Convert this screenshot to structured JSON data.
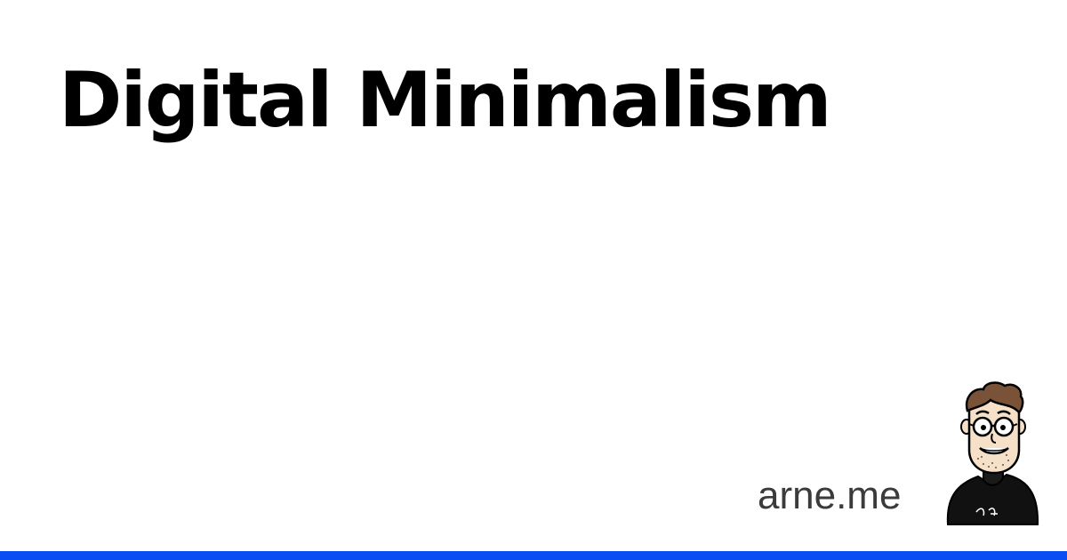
{
  "card": {
    "title": "Digital Minimalism",
    "site_label": "arne.me"
  },
  "avatar": {
    "icon": "cartoon-avatar-icon"
  },
  "colors": {
    "background": "#ffffff",
    "title_text": "#000000",
    "site_text": "#3b3b3b",
    "accent_bar": "#0a4df2",
    "hair": "#7a5238",
    "skin": "#f6e0c8",
    "shirt": "#111111"
  }
}
